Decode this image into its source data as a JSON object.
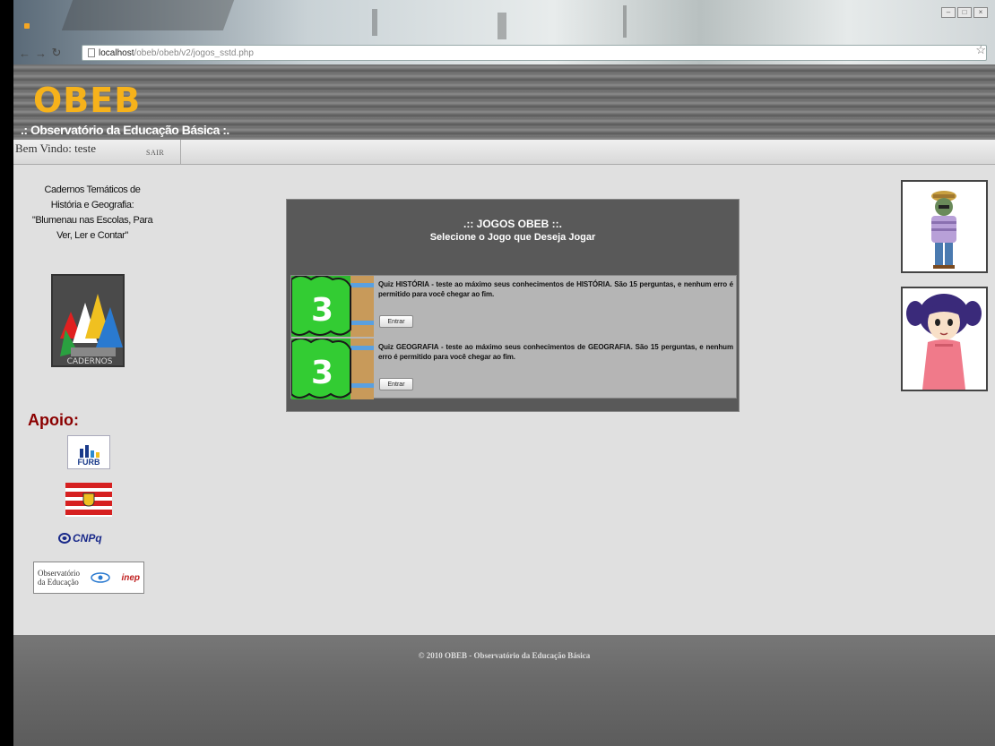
{
  "browser": {
    "url_host": "localhost",
    "url_path": "/obeb/obeb/v2/jogos_sstd.php"
  },
  "site": {
    "logo": "OBEB",
    "subtitle": ".: Observatório da Educação Básica :."
  },
  "userbar": {
    "welcome": "Bem Vindo: teste",
    "logout": "SAIR"
  },
  "sidebar": {
    "cadernos_title": "Cadernos Temáticos de História e Geografia: \"Blumenau nas Escolas, Para Ver, Ler e Contar\"",
    "apoio_label": "Apoio:",
    "sponsors": {
      "furb": "FURB",
      "cnpq": "CNPq",
      "obs_line1": "Observatório",
      "obs_line2": "da Educação",
      "inep": "inep"
    }
  },
  "games_panel": {
    "title": ".:: JOGOS OBEB ::.",
    "subtitle": "Selecione o Jogo que Deseja Jogar",
    "games": [
      {
        "number": "3",
        "description": "Quiz HISTÓRIA - teste ao máximo seus conhecimentos de HISTÓRIA. São 15 perguntas, e nenhum erro é permitido para você chegar ao fim.",
        "button": "Entrar"
      },
      {
        "number": "3",
        "description": "Quiz GEOGRAFIA - teste ao máximo seus conhecimentos de GEOGRAFIA. São 15 perguntas, e nenhum erro é permitido para você chegar ao fim.",
        "button": "Entrar"
      }
    ]
  },
  "footer": {
    "text": "© 2010 OBEB - Observatório da Educação Básica"
  },
  "colors": {
    "logo": "#f6b21b",
    "apoio": "#8b0000",
    "panel": "#595959"
  }
}
